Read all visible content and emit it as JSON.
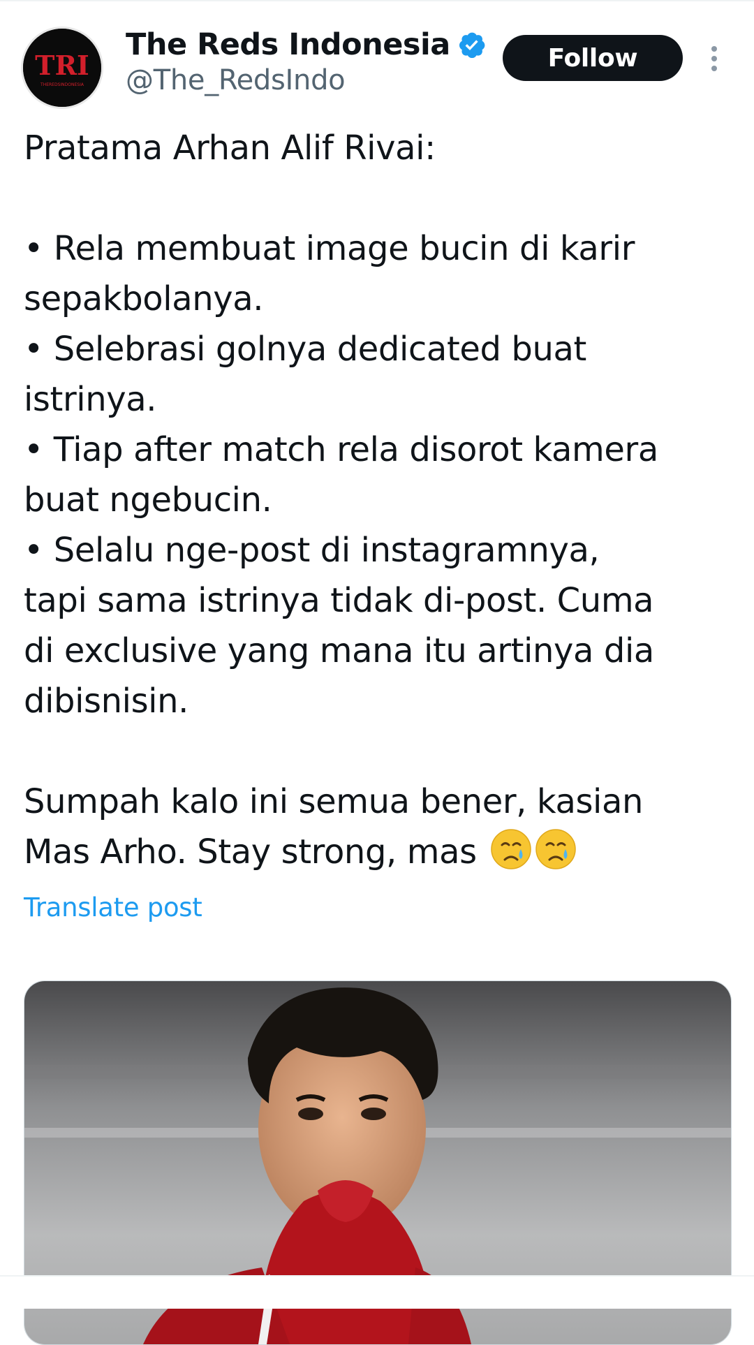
{
  "account": {
    "display_name": "The Reds Indonesia",
    "handle": "@The_RedsIndo",
    "verified": true,
    "avatar_logo_text": "TRI",
    "avatar_logo_subtext": "THEREDSINDONESIA"
  },
  "actions": {
    "follow_label": "Follow",
    "more_icon": "more-vertical-icon"
  },
  "post": {
    "lines": [
      "Pratama Arhan Alif Rivai:",
      "",
      "• Rela membuat image bucin di karir",
      "sepakbolanya.",
      "• Selebrasi golnya dedicated buat",
      "istrinya.",
      "• Tiap after match rela disorot kamera",
      "buat ngebucin.",
      "• Selalu nge-post di instagramnya,",
      "tapi sama istrinya tidak di-post. Cuma",
      "di exclusive yang mana itu artinya dia",
      "dibisnisin.",
      "",
      "Sumpah kalo ini semua bener, kasian"
    ],
    "last_line": "Mas Arho. Stay strong, mas",
    "emojis": [
      "crying-face-emoji",
      "crying-face-emoji"
    ],
    "translate_label": "Translate post"
  },
  "colors": {
    "text": "#0f1419",
    "secondary": "#536471",
    "link": "#1d9bf0",
    "verified": "#1d9bf0",
    "button_bg": "#0f1419",
    "jersey_red": "#b3141c"
  }
}
